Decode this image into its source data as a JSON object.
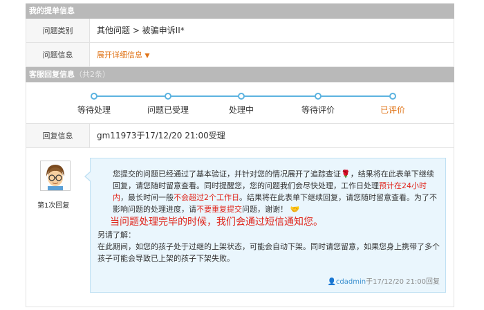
{
  "order_header": "我的提单信息",
  "category_label": "问题类别",
  "category_value": "其他问题 > 被骗申诉II*",
  "info_label": "问题信息",
  "expand_label": "展开详细信息",
  "reply_header": "客服回复信息",
  "reply_count": "（共2条）",
  "steps": [
    "等待处理",
    "问题已受理",
    "处理中",
    "等待评价",
    "已评价"
  ],
  "reply_info_label": "回复信息",
  "reply_info_value": "gm11973于17/12/20 21:00受理",
  "reply_nth": "第1次回复",
  "msg": {
    "p1a": "您提交的问题已经通过了基本验证，并针对您的情况展开了追踪查证",
    "p1b": "，结果将在此表单下继续回复，请您随时留意查看。同时提醒您，您的问题我们会尽快处理，工作日处理",
    "p1c": "预计在24小时内",
    "p1d": "，最长时间一般",
    "p1e": "不会超过2个工作日",
    "p1f": "。结果将在此表单下继续回复，请您随时留意查看。为了不影响问题的处理进度，请",
    "p1g": "不要重复提交",
    "p1h": "问题，谢谢！",
    "highlight": "当问题处理完毕的时候，我们会通过短信通知您。",
    "also": "另请了解：",
    "p2": "在此期间，如您的孩子处于过继的上架状态，可能会自动下架。同时请您留意，如果您身上携带了多个孩子可能会导致已上架的孩子下架失败。",
    "author": "cdadmin",
    "time": "于17/12/20 21:00回复"
  }
}
